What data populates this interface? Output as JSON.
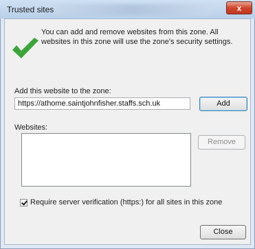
{
  "window": {
    "title": "Trusted sites",
    "close_glyph": "x"
  },
  "info": {
    "icon": "green-checkmark-icon",
    "text": "You can add and remove websites from this zone. All websites in this zone will use the zone's security settings."
  },
  "add_site": {
    "label": "Add this website to the zone:",
    "value": "https://athome.saintjohnfisher.staffs.sch.uk",
    "button": "Add"
  },
  "websites": {
    "label": "Websites:",
    "items": [],
    "remove_button": "Remove"
  },
  "verification": {
    "checked": true,
    "label": "Require server verification (https:) for all sites in this zone"
  },
  "footer": {
    "close_button": "Close"
  },
  "colors": {
    "title_bar": "#b9d0ea",
    "close_button": "#c8432a",
    "check_green": "#3aa53a"
  }
}
